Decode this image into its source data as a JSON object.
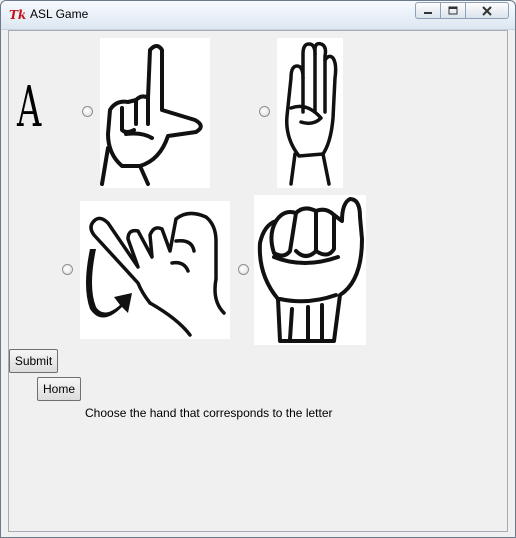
{
  "window": {
    "title": "ASL Game",
    "app_icon": "tk-feather-icon"
  },
  "controls": {
    "minimize_icon": "minimize-icon",
    "maximize_icon": "maximize-icon",
    "close_icon": "close-icon"
  },
  "prompt_letter": "A",
  "options": [
    {
      "id": "L",
      "icon": "asl-hand-L"
    },
    {
      "id": "B",
      "icon": "asl-hand-B"
    },
    {
      "id": "J",
      "icon": "asl-hand-J"
    },
    {
      "id": "A",
      "icon": "asl-hand-A"
    }
  ],
  "buttons": {
    "submit": "Submit",
    "home": "Home"
  },
  "instruction": "Choose the hand that corresponds to the letter"
}
